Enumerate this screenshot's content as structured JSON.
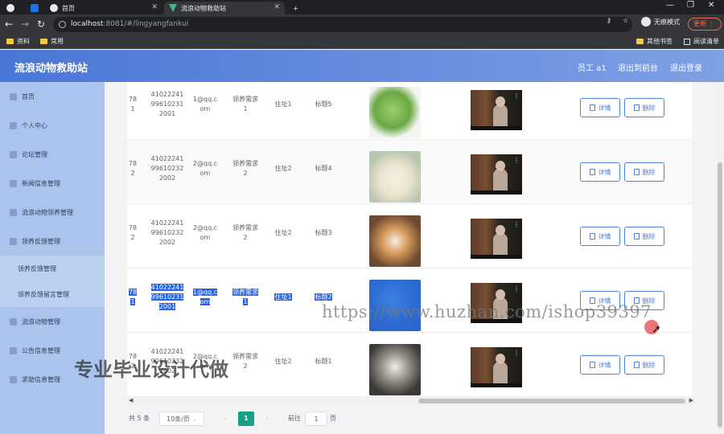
{
  "browser": {
    "tabs": [
      {
        "label": "",
        "active": false
      },
      {
        "label": "",
        "active": false
      },
      {
        "label": "首页",
        "active": false
      },
      {
        "label": "流浪动物救助站",
        "active": true
      }
    ],
    "new_tab": "+",
    "url_host": "localhost",
    "url_path": ":8081/#/lingyangfankui",
    "incognito_label": "无痕模式",
    "update_label": "更新",
    "bookmarks": [
      "资料",
      "常用"
    ],
    "other_bookmarks": "其他书签",
    "reading_list": "阅读清单"
  },
  "app": {
    "title": "流浪动物救助站",
    "user_label": "员工 a1",
    "back_label": "退出到前台",
    "logout_label": "退出登录"
  },
  "sidebar": {
    "items": [
      {
        "label": "首页",
        "icon": "home-icon"
      },
      {
        "label": "个人中心",
        "icon": "user-icon"
      },
      {
        "label": "论坛管理",
        "icon": "forum-icon"
      },
      {
        "label": "新闻信息管理",
        "icon": "news-icon"
      },
      {
        "label": "流浪动物领养管理",
        "icon": "adopt-icon"
      },
      {
        "label": "领养反馈管理",
        "icon": "feedback-icon"
      }
    ],
    "subitems": [
      "领养反馈管理",
      "领养反馈留言管理"
    ],
    "items_after": [
      {
        "label": "流浪动物管理",
        "icon": "animal-icon"
      },
      {
        "label": "公告信息管理",
        "icon": "notice-icon"
      },
      {
        "label": "求助信息管理",
        "icon": "help-icon"
      }
    ]
  },
  "table": {
    "rows": [
      {
        "c1": [
          "78",
          "1"
        ],
        "idcard": [
          "41022241",
          "99610231",
          "2001"
        ],
        "email": [
          "1@qq.c",
          "om"
        ],
        "need": [
          "领养需求",
          "1"
        ],
        "addr": "住址1",
        "title": "标题5",
        "pet": "cabbage",
        "highlight": false
      },
      {
        "c1": [
          "78",
          "2"
        ],
        "idcard": [
          "41022241",
          "99610232",
          "2002"
        ],
        "email": [
          "2@qq.c",
          "om"
        ],
        "need": [
          "领养需求",
          "2"
        ],
        "addr": "住址2",
        "title": "标题4",
        "pet": "bear",
        "highlight": false
      },
      {
        "c1": [
          "78",
          "2"
        ],
        "idcard": [
          "41022241",
          "99610232",
          "2002"
        ],
        "email": [
          "2@qq.c",
          "om"
        ],
        "need": [
          "领养需求",
          "2"
        ],
        "addr": "住址2",
        "title": "标题3",
        "pet": "shiba",
        "highlight": false
      },
      {
        "c1": [
          "78",
          "1"
        ],
        "idcard": [
          "41022241",
          "99610231",
          "2001"
        ],
        "email": [
          "1@qq.c",
          "om"
        ],
        "need": [
          "领养需求",
          "1"
        ],
        "addr": "住址1",
        "title": "标题2",
        "pet": "blue",
        "highlight": true
      },
      {
        "c1": [
          "78",
          "2"
        ],
        "idcard": [
          "41022241",
          "99610232",
          "2002"
        ],
        "email": [
          "2@qq.c",
          "om"
        ],
        "need": [
          "领养需求",
          "2"
        ],
        "addr": "住址2",
        "title": "标题1",
        "pet": "cat",
        "highlight": false
      }
    ],
    "detail_label": "详情",
    "delete_label": "删除"
  },
  "pager": {
    "total": "共 5 条",
    "page_size": "10条/页",
    "current": "1",
    "goto_prefix": "前往",
    "goto_value": "1",
    "goto_suffix": "页"
  },
  "overlay": {
    "watermark_url": "https://www.huzhan.com/ishop39397",
    "watermark_cn": "专业毕业设计代做"
  }
}
